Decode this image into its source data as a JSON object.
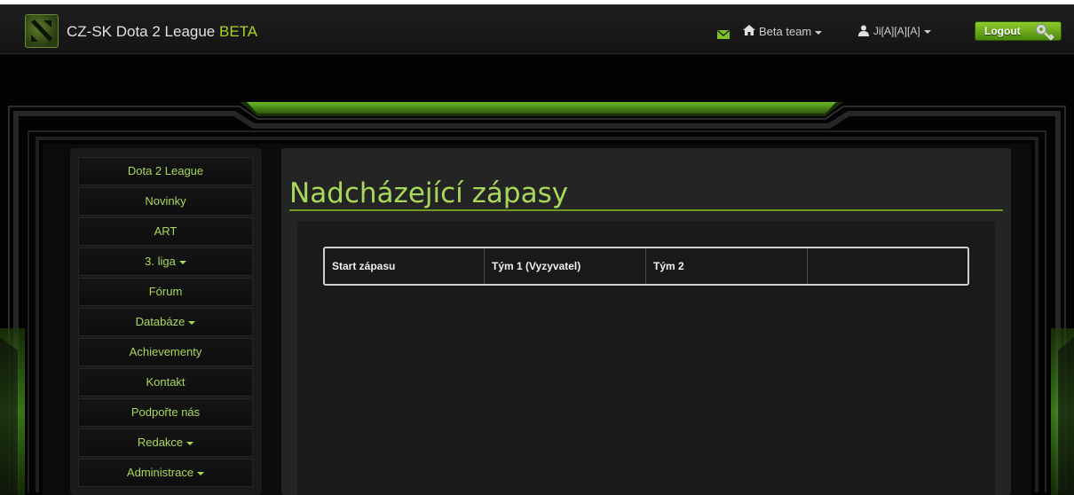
{
  "navbar": {
    "brand_name": "CZ-SK Dota 2 League",
    "brand_tag": "BETA",
    "team_menu": "Beta team",
    "user_menu": "Ji[A][A][A]",
    "logout_label": "Logout"
  },
  "sidebar": {
    "items": [
      {
        "label": "Dota 2 League"
      },
      {
        "label": "Novinky"
      },
      {
        "label": "ART"
      },
      {
        "label": "3. liga"
      },
      {
        "label": "Fórum"
      },
      {
        "label": "Databáze"
      },
      {
        "label": "Achievementy"
      },
      {
        "label": "Kontakt"
      },
      {
        "label": "Podpořte nás"
      },
      {
        "label": "Redakce"
      },
      {
        "label": "Administrace"
      }
    ]
  },
  "main": {
    "title": "Nadcházející zápasy",
    "table": {
      "headers": [
        "Start zápasu",
        "Tým 1 (Vyzyvatel)",
        "Tým 2",
        ""
      ]
    }
  },
  "colors": {
    "accent": "#a8d85a",
    "brand_beta": "#a6d424",
    "logout_bg": "#6aa51c"
  },
  "icons": [
    "dota-logo-icon",
    "mail-icon",
    "home-icon",
    "user-icon",
    "key-icon",
    "caret-down-icon"
  ]
}
